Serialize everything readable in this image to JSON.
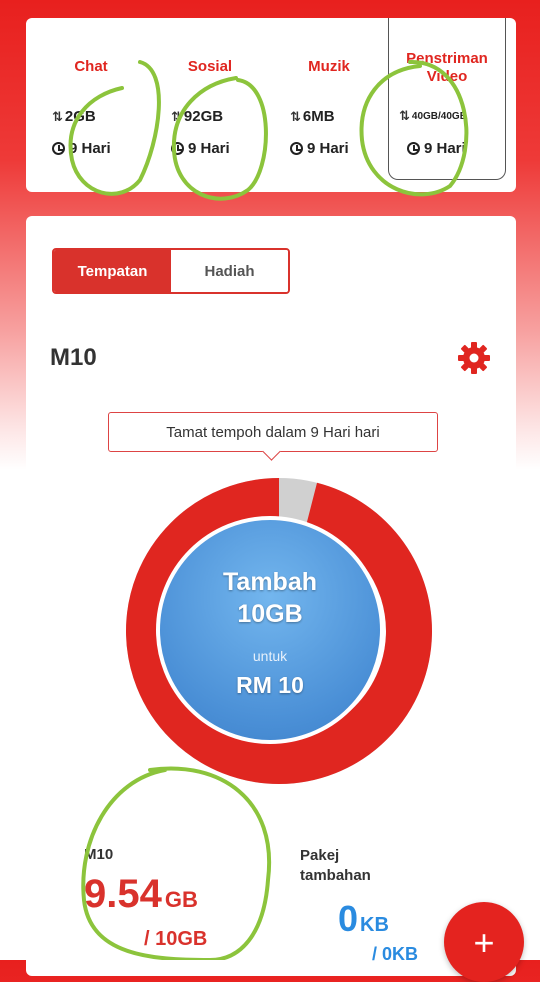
{
  "colors": {
    "brand_red": "#d9322c",
    "accent_blue": "#2a8be0",
    "annotation_green": "#8cc43c"
  },
  "categories": [
    {
      "label": "Chat",
      "data": "2GB",
      "days": "9 Hari"
    },
    {
      "label": "Sosial",
      "data": "92GB",
      "days": "9 Hari"
    },
    {
      "label": "Muzik",
      "data": "6MB",
      "days": "9 Hari"
    },
    {
      "label": "Penstriman Video",
      "data": "40GB/40GB",
      "days": "9 Hari"
    }
  ],
  "tabs": {
    "active": "Tempatan",
    "inactive": "Hadiah"
  },
  "plan": {
    "name": "M10"
  },
  "tooltip": {
    "text": "Tamat tempoh dalam 9 Hari hari"
  },
  "donut": {
    "used_fraction": 0.96
  },
  "promo": {
    "line1": "Tambah",
    "line2": "10GB",
    "line3": "untuk",
    "line4": "RM 10"
  },
  "usage": {
    "label": "M10",
    "value": "9.54",
    "unit": "GB",
    "total": "/ 10GB"
  },
  "addon": {
    "label": "Pakej tambahan",
    "value": "0",
    "unit": "KB",
    "partial": "/ 0KB"
  },
  "fab": {
    "label": "+"
  },
  "icons": {
    "data": "arrows-up-down-icon",
    "time": "clock-icon",
    "settings": "gear-icon"
  }
}
